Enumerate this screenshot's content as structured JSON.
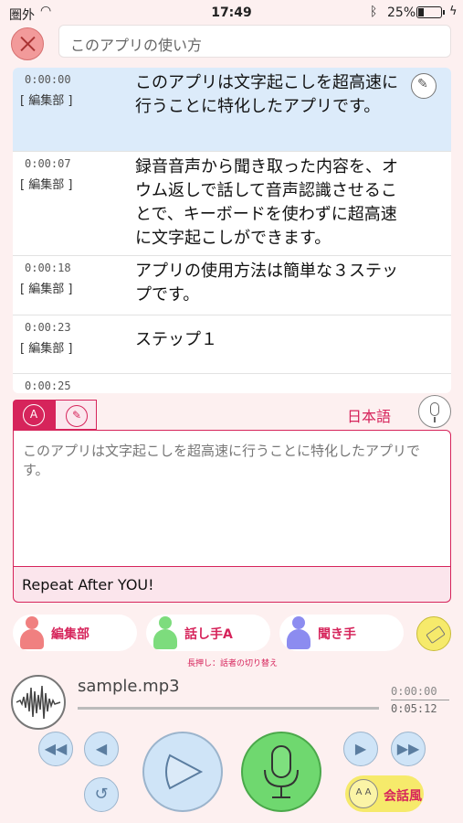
{
  "status_bar": {
    "carrier": "圏外",
    "time": "17:49",
    "battery": "25%",
    "battery_level": 0.25
  },
  "header": {
    "title": "このアプリの使い方"
  },
  "transcript": [
    {
      "time": "0:00:00",
      "speaker": "[ 編集部 ]",
      "text": "このアプリは文字起こしを超高速に行うことに特化したアプリです。",
      "selected": true
    },
    {
      "time": "0:00:07",
      "speaker": "[ 編集部 ]",
      "text": "録音音声から聞き取った内容を、オウム返しで話して音声認識させることで、キーボードを使わずに超高速に文字起こしができます。"
    },
    {
      "time": "0:00:18",
      "speaker": "[ 編集部 ]",
      "text": "アプリの使用方法は簡単な３ステップです。"
    },
    {
      "time": "0:00:23",
      "speaker": "[ 編集部 ]",
      "text": "ステップ１"
    },
    {
      "time": "0:00:25",
      "speaker": "",
      "text": ""
    }
  ],
  "input_panel": {
    "language": "日本語",
    "text": "このアプリは文字起こしを超高速に行うことに特化したアプリです。",
    "footer": "Repeat After YOU!"
  },
  "speakers": [
    {
      "label": "編集部",
      "color": "#f08080"
    },
    {
      "label": "話し手A",
      "color": "#7ddc7d"
    },
    {
      "label": "聞き手",
      "color": "#8c8cf0"
    }
  ],
  "speaker_hint": "長押し：話者の切り替え",
  "player": {
    "filename": "sample.mp3",
    "current_time": "0:00:00",
    "total_time": "0:05:12",
    "progress": 0.0,
    "mode_label": "会話風"
  }
}
